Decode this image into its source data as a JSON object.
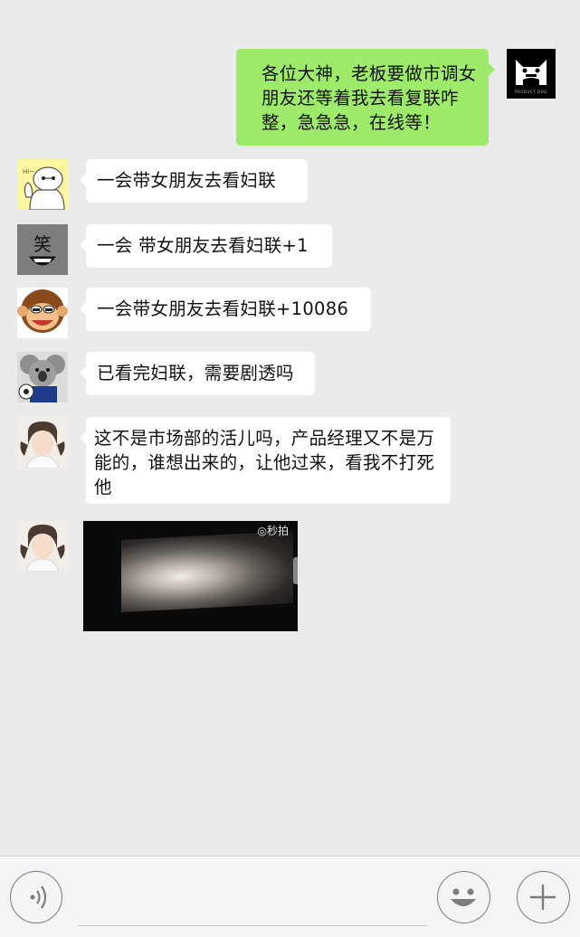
{
  "messages": [
    {
      "side": "right",
      "text": "各位大神，老板要做市调女朋友还等着我去看复联咋整，急急急，在线等！",
      "avatar": "project-dog-avatar"
    },
    {
      "side": "left",
      "text": "一会带女朋友去看妇联",
      "avatar": "baymax-avatar"
    },
    {
      "side": "left",
      "text": "一会 带女朋友去看妇联+1",
      "avatar": "laugh-face-avatar"
    },
    {
      "side": "left",
      "text": "一会带女朋友去看妇联+10086",
      "avatar": "monkey-avatar"
    },
    {
      "side": "left",
      "text": "已看完妇联，需要剧透吗",
      "avatar": "koala-avatar"
    },
    {
      "side": "left",
      "text": "这不是市场部的活儿吗，产品经理又不是万能的，谁想出来的，让他过来，看我不打死他",
      "avatar": "girl-avatar"
    },
    {
      "side": "left",
      "type": "video",
      "watermark": "◎秒拍",
      "avatar": "girl-avatar"
    }
  ],
  "avatar_texts": {
    "dog": "PRODUCT DOG",
    "laugh": "笑",
    "koala_shirt": "1816\nCFRKE"
  },
  "input_bar": {
    "voice_icon": "voice-icon",
    "emoji_icon": "emoji-icon",
    "plus_icon": "plus-icon",
    "value": ""
  },
  "colors": {
    "background": "#ebebeb",
    "my_bubble": "#9eea6a",
    "other_bubble": "#ffffff"
  }
}
